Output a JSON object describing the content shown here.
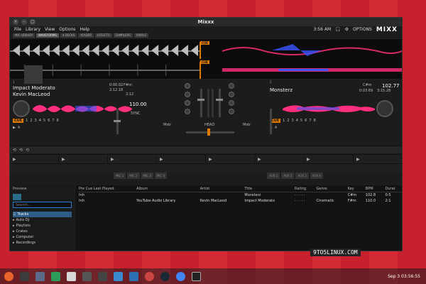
{
  "window": {
    "title": "Mixxx",
    "close": "×",
    "min": "–",
    "max": "□"
  },
  "menu": [
    "File",
    "Library",
    "View",
    "Options",
    "Help"
  ],
  "header": {
    "time": "3:56 AM",
    "options": "OPTIONS",
    "logo": "MIXX"
  },
  "toggles": [
    "MIC LIBRARY",
    "WAVEFORMS",
    "4 DECKS",
    "XFADER",
    "EFFECTS",
    "SAMPLERS",
    "VINYLS"
  ],
  "deck1": {
    "num": "1",
    "title": "Impact Moderato",
    "artist": "Kevin MacLeod",
    "key": "F#m",
    "bpm": "110.00",
    "time1": "0:00.02",
    "time2": "2:12.18",
    "rate": "2:12",
    "sync": "SYNC",
    "cue": "CUE",
    "hotcues": [
      "1",
      "2",
      "3",
      "4",
      "5",
      "6",
      "7",
      "8"
    ],
    "loops": [
      "4"
    ]
  },
  "deck2": {
    "num": "2",
    "title": "Monsterz",
    "key": "C#m",
    "bpm": "102.77",
    "time1": "0:03.69",
    "time2": "3:15.28",
    "cue": "CUE",
    "hotcues": [
      "1",
      "2",
      "3",
      "4",
      "5",
      "6",
      "7",
      "8"
    ],
    "loops": [
      "4"
    ]
  },
  "mixer": {
    "cue_l": "Mstr",
    "cue_r": "Mstr",
    "head": "HEAD"
  },
  "fx_left": [
    "MIC 1",
    "MIC 2",
    "MIC 3",
    "MIC 4"
  ],
  "fx_right": [
    "AUX 1",
    "AUX 2",
    "AUX 3",
    "AUX 4"
  ],
  "sidebar": {
    "preview": "Preview",
    "search_placeholder": "Search...",
    "items": [
      "Tracks",
      "Auto DJ",
      "Playlists",
      "Crates",
      "Computer",
      "Recordings"
    ]
  },
  "library": {
    "columns": [
      "Pre Cue Last Played",
      "Album",
      "Artist",
      "Title",
      "Rating",
      "Genre",
      "Key",
      "BPM",
      "Durat"
    ],
    "rows": [
      {
        "pre": "Inh",
        "album": "",
        "artist": "",
        "title": "Monsterz",
        "rating": "· · · · ·",
        "genre": "",
        "key": "C#m",
        "bpm": "102.8",
        "dur": "0:5"
      },
      {
        "pre": "Inh",
        "album": "YouTube Audio Library",
        "artist": "Kevin MacLeod",
        "title": "Impact Moderato",
        "rating": "· · · · ·",
        "genre": "Cinematic",
        "key": "F#m",
        "bpm": "110.0",
        "dur": "2:1"
      }
    ]
  },
  "watermark": "9TO5LINUX.COM",
  "taskbar": {
    "date": "Sep 3",
    "time": "03:56:55"
  },
  "colors": {
    "accent": "#e07b00",
    "wave_pink": "#ff2f7d",
    "wave_blue": "#3a55ff",
    "select": "#2d5d86"
  }
}
